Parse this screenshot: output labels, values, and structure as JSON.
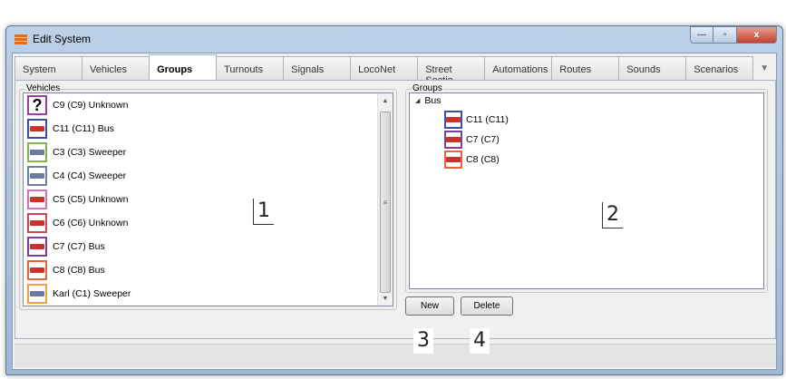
{
  "window": {
    "title": "Edit System"
  },
  "window_buttons": {
    "minimize": "—",
    "maximize": "▫",
    "close": "x"
  },
  "tabs": [
    {
      "label": "System",
      "w": 76
    },
    {
      "label": "Vehicles",
      "w": 76
    },
    {
      "label": "Groups",
      "w": 76,
      "active": true
    },
    {
      "label": "Turnouts",
      "w": 76
    },
    {
      "label": "Signals",
      "w": 76
    },
    {
      "label": "LocoNet",
      "w": 76
    },
    {
      "label": "Street Sectio...",
      "w": 76
    },
    {
      "label": "Automations",
      "w": 76
    },
    {
      "label": "Routes",
      "w": 76
    },
    {
      "label": "Sounds",
      "w": 76
    },
    {
      "label": "Scenarios",
      "w": 76
    }
  ],
  "vehicles": {
    "label": "Vehicles",
    "items": [
      {
        "text": "C9 (C9) Unknown",
        "icon": "question-icon",
        "color": "#9b3fa0"
      },
      {
        "text": "C11 (C11) Bus",
        "icon": "bus-icon",
        "color": "#3b4fa8"
      },
      {
        "text": "C3 (C3) Sweeper",
        "icon": "sweeper-icon",
        "color": "#7fb54a"
      },
      {
        "text": "C4 (C4) Sweeper",
        "icon": "sweeper-icon",
        "color": "#6c7fa8"
      },
      {
        "text": "C5 (C5) Unknown",
        "icon": "truck-icon",
        "color": "#d870b8"
      },
      {
        "text": "C6 (C6) Unknown",
        "icon": "truck-icon",
        "color": "#c84a5a"
      },
      {
        "text": "C7 (C7) Bus",
        "icon": "bus-icon",
        "color": "#7a3f9b"
      },
      {
        "text": "C8 (C8) Bus",
        "icon": "bus-icon",
        "color": "#e8643a"
      },
      {
        "text": "Karl (C1) Sweeper",
        "icon": "sweeper-icon",
        "color": "#f0a040"
      },
      {
        "text": "",
        "icon": "truck-icon",
        "color": "#e8643a"
      }
    ]
  },
  "groups": {
    "label": "Groups",
    "root": "Bus",
    "children": [
      {
        "text": "C11 (C11)",
        "color": "#3b4fa8"
      },
      {
        "text": "C7 (C7)",
        "color": "#7a3f9b"
      },
      {
        "text": "C8 (C8)",
        "color": "#e8643a"
      }
    ]
  },
  "buttons": {
    "new": "New",
    "delete": "Delete"
  },
  "callouts": {
    "c1": "1",
    "c2": "2",
    "c3": "3",
    "c4": "4"
  }
}
